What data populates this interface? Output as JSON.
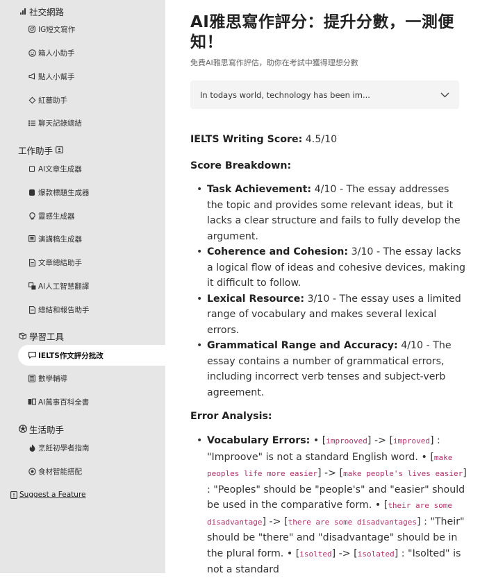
{
  "sidebar": {
    "sections": [
      {
        "title": "社交網路",
        "items": [
          "IG短文寫作",
          "箱人小助手",
          "點人小幫手",
          "紅蕃助手",
          "聊天記錄總結"
        ]
      },
      {
        "title": "工作助手",
        "items": [
          "AI文章生成器",
          "爆款標題生成器",
          "靈感生成器",
          "演講稿生成器",
          "文章總結助手",
          "AI人工智慧翻譯",
          "總結和報告助手"
        ]
      },
      {
        "title": "學習工具",
        "items": [
          "IELTS作文評分批改",
          "數學輔導",
          "AI萬事百科全書"
        ]
      },
      {
        "title": "生活助手",
        "items": [
          "烹飪初學者指南",
          "食材智能搭配"
        ]
      }
    ],
    "active_item": "IELTS作文評分批改",
    "suggest_label": "Suggest a Feature"
  },
  "main": {
    "title": "AI雅思寫作評分：提升分數，一測便知！",
    "subtitle": "免費AI雅思寫作評估，助你在考試中獲得理想分數",
    "essay_select_value": "In todays world, technology has been im...",
    "score_label": "IELTS Writing Score:",
    "score_value": "4.5/10",
    "breakdown_heading": "Score Breakdown:",
    "breakdown": [
      {
        "criterion": "Task Achievement:",
        "text": "4/10 - The essay addresses the topic and provides some relevant ideas, but it lacks a clear structure and fails to fully develop the argument."
      },
      {
        "criterion": "Coherence and Cohesion:",
        "text": "3/10 - The essay lacks a logical flow of ideas and cohesive devices, making it difficult to follow."
      },
      {
        "criterion": "Lexical Resource:",
        "text": "3/10 - The essay uses a limited range of vocabulary and makes several lexical errors."
      },
      {
        "criterion": "Grammatical Range and Accuracy:",
        "text": "4/10 - The essay contains a number of grammatical errors, including incorrect verb tenses and subject-verb agreement."
      }
    ],
    "error_heading": "Error Analysis:",
    "vocab_label": "Vocabulary Errors:",
    "vocab_errors": [
      {
        "wrong": "improoved",
        "right": "improved",
        "explanation": ": \"Improove\" is not a standard English word."
      },
      {
        "wrong": "make peoples life more easier",
        "right": "make people's lives easier",
        "explanation": ": \"Peoples\" should be \"people's\" and \"easier\" should be used in the comparative form."
      },
      {
        "wrong": "their are some disadvantage",
        "right": "there are some disadvantages",
        "explanation": ": \"Their\" should be \"there\" and \"disadvantage\" should be in the plural form."
      },
      {
        "wrong": "isolted",
        "right": "isolated",
        "explanation": ": \"Isolted\" is not a standard"
      }
    ]
  },
  "colors": {
    "sidebar_bg": "#e6e6e6",
    "code_text": "#b0306a",
    "select_bg": "#f4f4f4"
  }
}
